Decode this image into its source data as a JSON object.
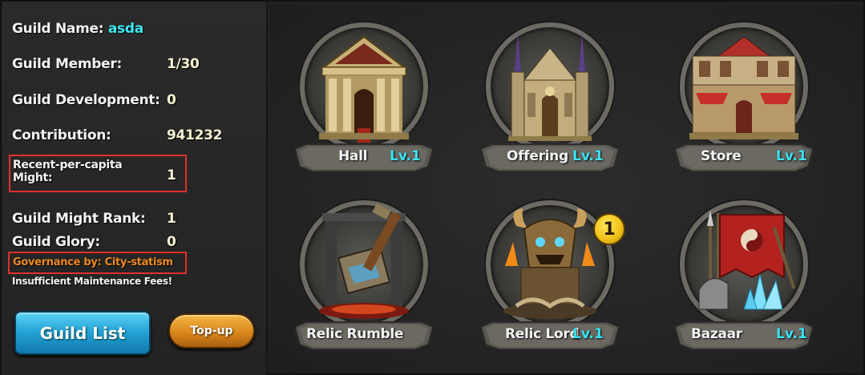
{
  "guild_info": {
    "name_label": "Guild Name:",
    "name_value": "asda",
    "member_label": "Guild Member:",
    "member_value": "1/30",
    "development_label": "Guild Development:",
    "development_value": "0",
    "contribution_label": "Contribution:",
    "contribution_value": "941232",
    "recent_might_label_line1": "Recent-per-capita",
    "recent_might_label_line2": "Might:",
    "recent_might_value": "1",
    "might_rank_label": "Guild Might Rank:",
    "might_rank_value": "1",
    "glory_label": "Guild Glory:",
    "glory_value": "0",
    "governance": "Governance by: City-statism",
    "maintenance_warning": "Insufficient Maintenance Fees!"
  },
  "buttons": {
    "guild_list": "Guild List",
    "top_up": "Top-up"
  },
  "buildings": [
    {
      "name": "Hall",
      "level": "Lv.1",
      "icon": "temple-icon"
    },
    {
      "name": "Offering",
      "level": "Lv.1",
      "icon": "cathedral-icon"
    },
    {
      "name": "Store",
      "level": "Lv.1",
      "icon": "shop-icon"
    },
    {
      "name": "Relic Rumble",
      "level": "",
      "icon": "broken-hammer-icon"
    },
    {
      "name": "Relic Lord",
      "level": "Lv.1",
      "icon": "demon-throne-icon",
      "badge": "1"
    },
    {
      "name": "Bazaar",
      "level": "Lv.1",
      "icon": "banner-crystal-icon"
    }
  ],
  "colors": {
    "accent_cyan": "#3ee8f2",
    "governance_orange": "#f08a1e",
    "highlight_red": "#e0302e",
    "guild_list_blue": "#25a5d8",
    "topup_orange": "#d9871c"
  }
}
